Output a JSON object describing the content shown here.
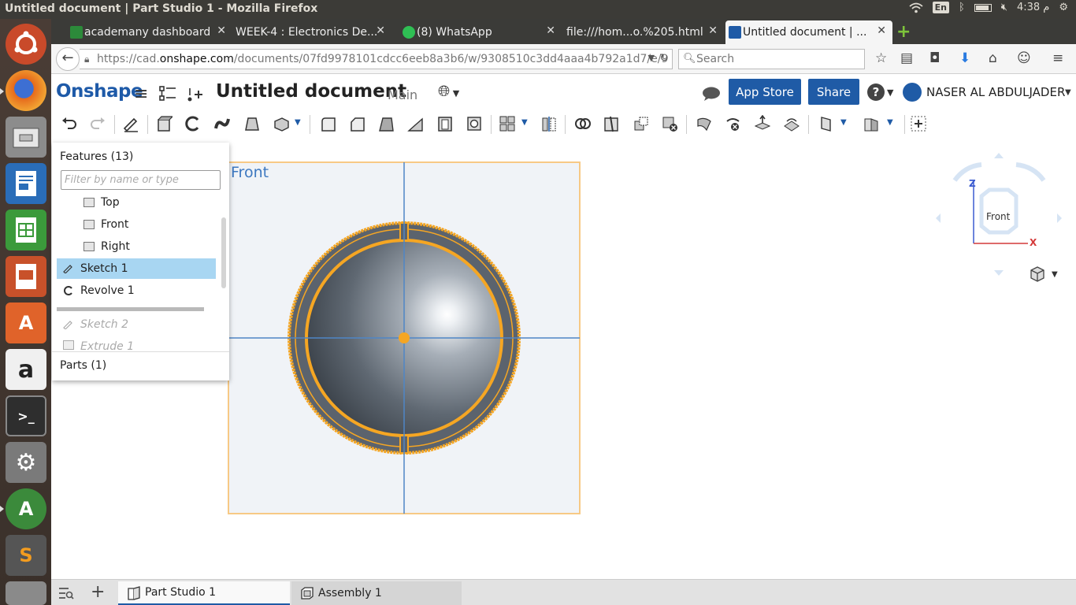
{
  "system": {
    "window_title": "Untitled document | Part Studio 1 - Mozilla Firefox",
    "language": "En",
    "clock": "4:38 م"
  },
  "browser": {
    "tabs": [
      {
        "label": "academany dashboard",
        "active": false
      },
      {
        "label": "WEEK-4 : Electronics De...",
        "active": false
      },
      {
        "label": "(8) WhatsApp",
        "active": false
      },
      {
        "label": "file:///hom...o.%205.html",
        "active": false
      },
      {
        "label": "Untitled document | ...",
        "active": true
      }
    ],
    "url_prefix": "https://cad.",
    "url_host": "onshape.com",
    "url_rest": "/documents/07fd9978101cdcc6eeb8a3b6/w/9308510c3dd4aaa4b792a1d7/e/9",
    "search_placeholder": "Search"
  },
  "onshape": {
    "logo": "Onshape",
    "doc_title": "Untitled document",
    "branch": "Main",
    "app_store_label": "App Store",
    "share_label": "Share",
    "user_name": "NASER AL ABDULJADER",
    "accent": "#1f5ba6"
  },
  "features": {
    "title": "Features (13)",
    "filter_placeholder": "Filter by name or type",
    "items": [
      {
        "label": "Top",
        "icon": "plane-icon"
      },
      {
        "label": "Front",
        "icon": "plane-icon"
      },
      {
        "label": "Right",
        "icon": "plane-icon"
      },
      {
        "label": "Sketch 1",
        "icon": "sketch-icon",
        "selected": true
      },
      {
        "label": "Revolve 1",
        "icon": "revolve-icon"
      },
      {
        "label": "Sketch 2",
        "icon": "sketch-icon",
        "suppressed": true
      },
      {
        "label": "Extrude 1",
        "icon": "extrude-icon",
        "suppressed": true
      }
    ],
    "parts_title": "Parts (1)"
  },
  "viewport": {
    "plane_label": "Front",
    "cube_label": "Front",
    "axis_z": "Z",
    "axis_x": "X",
    "sketch_color": "#f5a623"
  },
  "bottom_tabs": {
    "part_studio": "Part Studio 1",
    "assembly": "Assembly 1"
  }
}
